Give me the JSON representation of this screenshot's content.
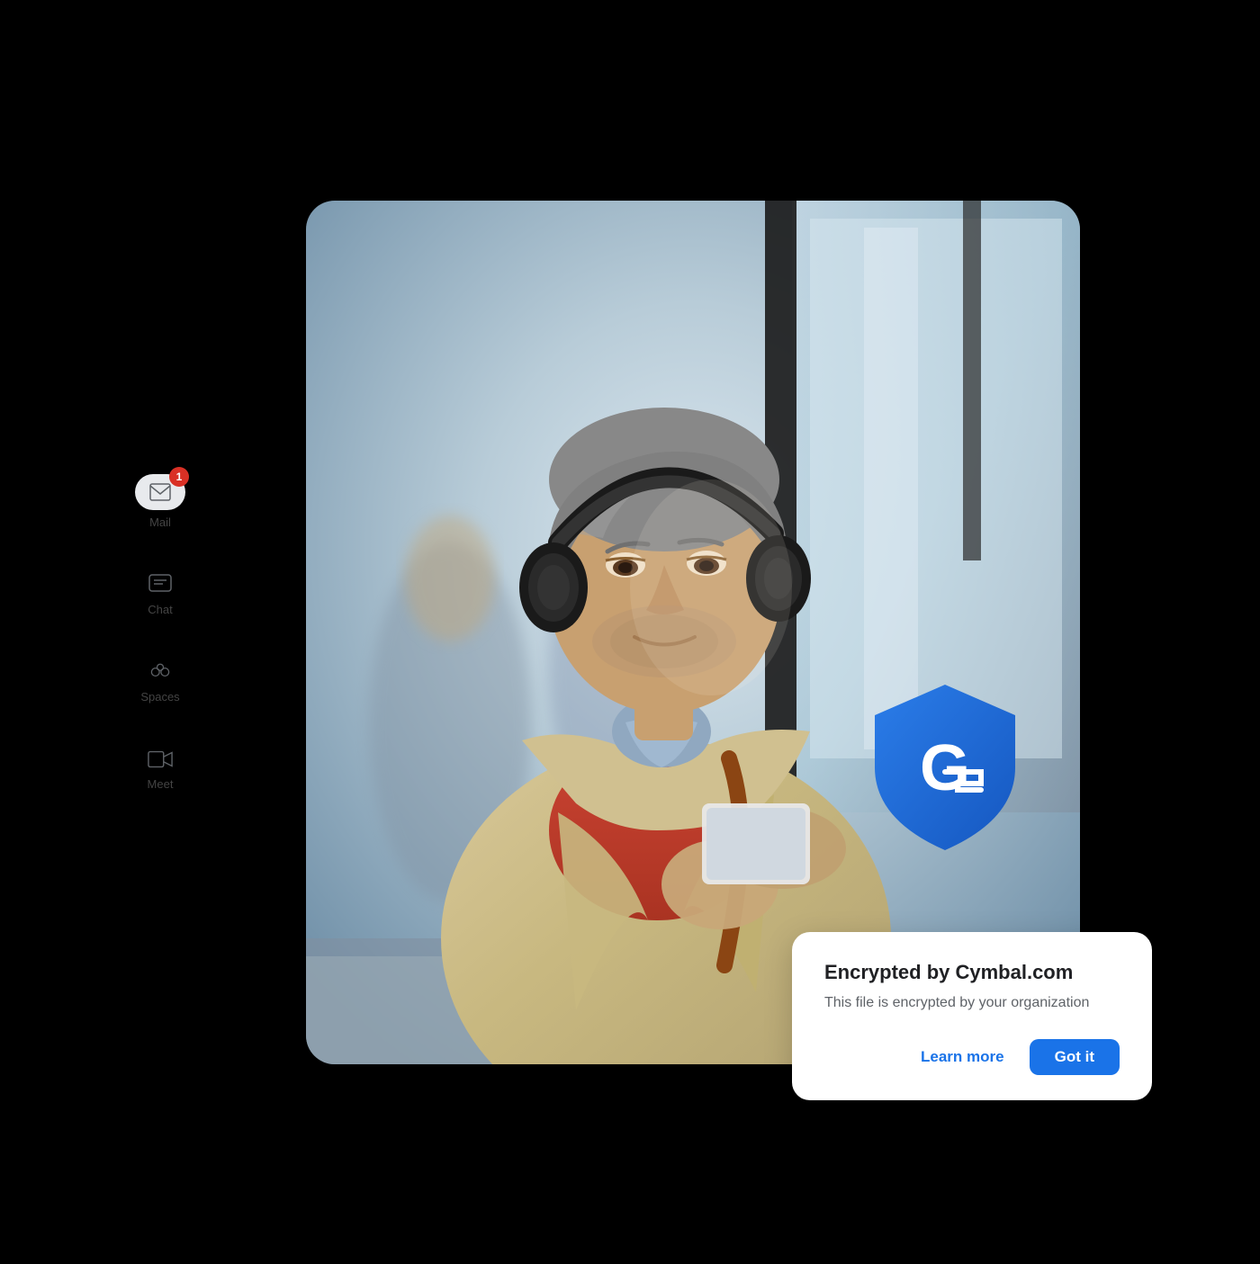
{
  "sidebar": {
    "items": [
      {
        "id": "mail",
        "label": "Mail",
        "badge": "1",
        "icon": "mail-icon"
      },
      {
        "id": "chat",
        "label": "Chat",
        "icon": "chat-icon"
      },
      {
        "id": "spaces",
        "label": "Spaces",
        "icon": "spaces-icon"
      },
      {
        "id": "meet",
        "label": "Meet",
        "icon": "meet-icon"
      }
    ]
  },
  "encryption_card": {
    "title": "Encrypted by Cymbal.com",
    "description": "This file is encrypted by your organization",
    "learn_more_label": "Learn more",
    "got_it_label": "Got it"
  },
  "colors": {
    "mail_badge": "#d93025",
    "active_pill": "#e8eaed",
    "learn_more": "#1a73e8",
    "got_it_bg": "#1a73e8",
    "shield_dark": "#1a56c4",
    "shield_light": "#1967d2"
  }
}
